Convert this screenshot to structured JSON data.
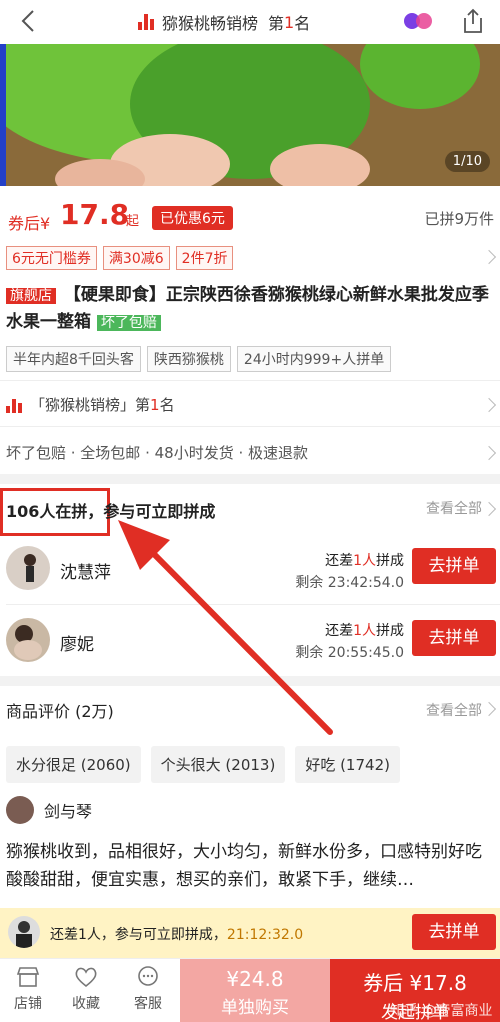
{
  "header": {
    "rank_prefix": "猕猴桃畅销榜",
    "rank_suffix_pre": "第",
    "rank_no": "1",
    "rank_suffix_post": "名"
  },
  "hero": {
    "page_indicator": "1/10"
  },
  "price": {
    "prefix": "券后¥",
    "value": "17.8",
    "qi": "起",
    "discount": "已优惠6元",
    "sold": "已拼9万件"
  },
  "coupons": [
    "6元无门槛券",
    "满30减6",
    "2件7折"
  ],
  "title": {
    "store_tag": "旗舰店",
    "text": "【硬果即食】正宗陕西徐香猕猴桃绿心新鲜水果批发应季水果一整箱",
    "green_tag": "坏了包赔"
  },
  "feature_tags": [
    "半年内超8千回头客",
    "陕西猕猴桃",
    "24小时内999+人拼单"
  ],
  "rank_row": {
    "pre": "「猕猴桃销榜」第",
    "no": "1",
    "post": "名"
  },
  "services": "坏了包赔 · 全场包邮 · 48小时发货 · 极速退款",
  "group": {
    "title": "106人在拼，参与可立即拼成",
    "more": "查看全部",
    "members": [
      {
        "name": "沈慧萍",
        "need_pre": "还差",
        "need_no": "1人",
        "need_post": "拼成",
        "remain": "剩余 23:42:54.0",
        "button": "去拼单"
      },
      {
        "name": "廖妮",
        "need_pre": "还差",
        "need_no": "1人",
        "need_post": "拼成",
        "remain": "剩余 20:55:45.0",
        "button": "去拼单"
      }
    ]
  },
  "reviews": {
    "title": "商品评价 (2万)",
    "more": "查看全部",
    "tags": [
      "水分很足 (2060)",
      "个头很大 (2013)",
      "好吃 (1742)"
    ],
    "reviewer": "剑与琴",
    "text": "猕猴桃收到，品相很好，大小均匀，新鲜水份多，口感特别好吃酸酸甜甜，便宜实惠，想买的亲们，敢紧下手，继续…"
  },
  "strip": {
    "text": "还差1人，参与可立即拼成，",
    "time": "21:12:32.0",
    "button": "去拼单"
  },
  "bottom_nav": {
    "store": "店铺",
    "favorite": "收藏",
    "service": "客服",
    "solo_price": "¥24.8",
    "solo_label": "单独购买",
    "group_price": "券后 ¥17.8",
    "group_label": "发起拼单"
  },
  "watermark": "知乎 @帝富商业",
  "colors": {
    "accent": "#e02e24",
    "soft": "#f3a7a3",
    "strip": "#fff3c4",
    "green": "#4cb75b"
  }
}
